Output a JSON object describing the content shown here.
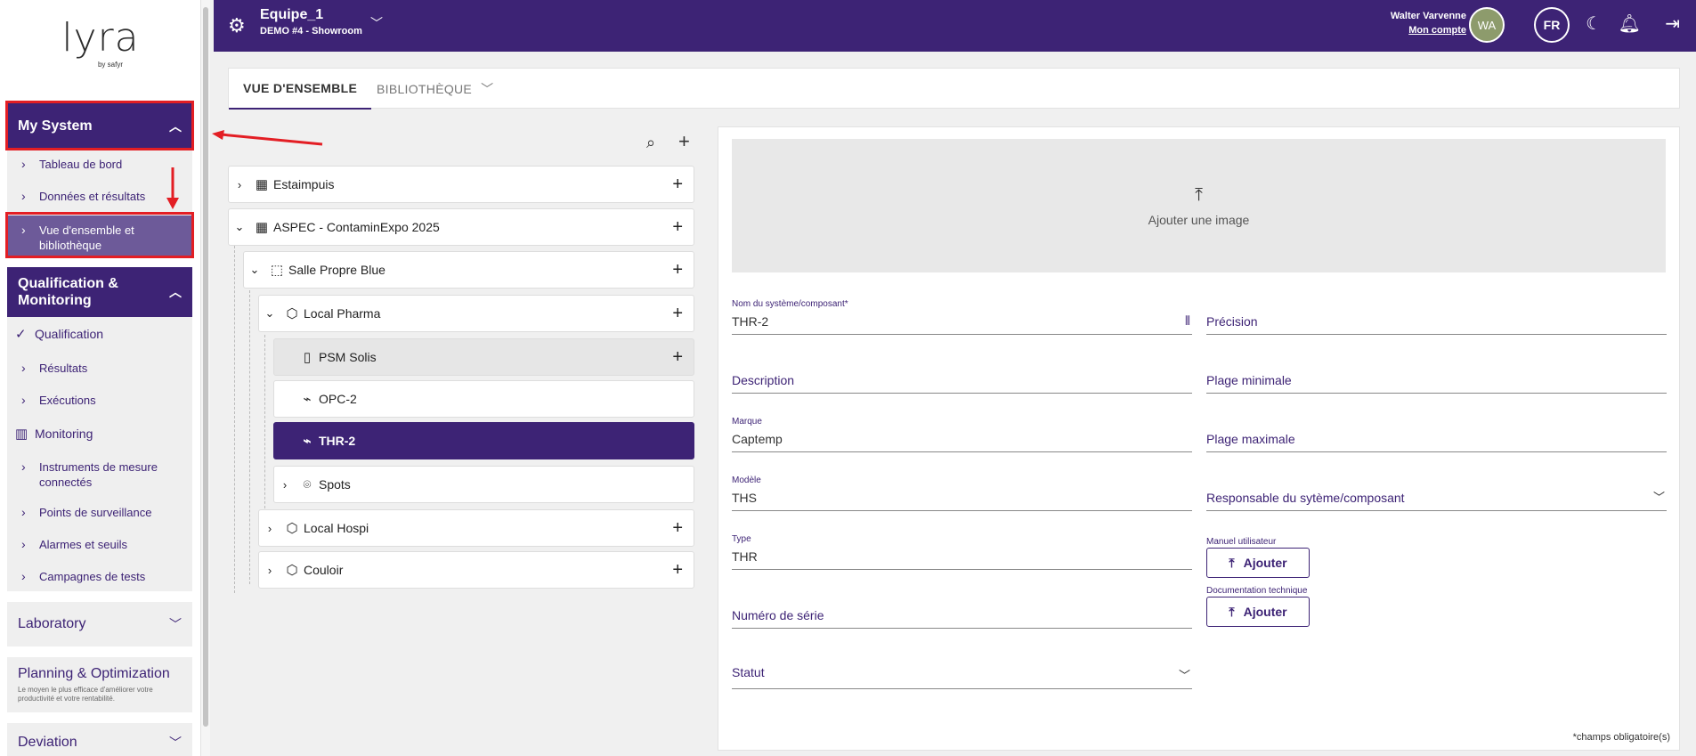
{
  "logo": {
    "word": "lyra",
    "by": "by safyr"
  },
  "sidebar": {
    "my_system": {
      "label": "My System",
      "items": [
        "Tableau de bord",
        "Données et résultats",
        "Vue d'ensemble et bibliothèque"
      ]
    },
    "qualification": {
      "label": "Qualification & Monitoring",
      "qualification_label": "Qualification",
      "qualification_items": [
        "Résultats",
        "Exécutions"
      ],
      "monitoring_label": "Monitoring",
      "monitoring_items": [
        "Instruments de mesure connectés",
        "Points de surveillance",
        "Alarmes et seuils",
        "Campagnes de tests"
      ]
    },
    "laboratory": {
      "label": "Laboratory"
    },
    "planning": {
      "label": "Planning & Optimization",
      "sub": "Le moyen le plus efficace d'améliorer votre productivité et votre rentabilité."
    },
    "deviation": {
      "label": "Deviation"
    }
  },
  "topbar": {
    "team": "Equipe_1",
    "site": "DEMO #4 - Showroom",
    "user_name": "Walter Varvenne",
    "account_link": "Mon compte",
    "avatar_initials": "WA",
    "language": "FR"
  },
  "tabs": {
    "overview": "VUE D'ENSEMBLE",
    "library": "BIBLIOTHÈQUE"
  },
  "tree": {
    "nodes": [
      {
        "label": "Estaimpuis"
      },
      {
        "label": "ASPEC - ContaminExpo 2025"
      },
      {
        "label": "Salle Propre Blue"
      },
      {
        "label": "Local Pharma"
      },
      {
        "label": "PSM Solis"
      },
      {
        "label": "OPC-2"
      },
      {
        "label": "THR-2"
      },
      {
        "label": "Spots"
      },
      {
        "label": "Local Hospi"
      },
      {
        "label": "Couloir"
      }
    ]
  },
  "detail": {
    "upload_label": "Ajouter une image",
    "name_label": "Nom du système/composant*",
    "name_value": "THR-2",
    "precision_label": "Précision",
    "description_label": "Description",
    "min_range_label": "Plage minimale",
    "brand_label": "Marque",
    "brand_value": "Captemp",
    "max_range_label": "Plage maximale",
    "model_label": "Modèle",
    "model_value": "THS",
    "owner_label": "Responsable du sytème/composant",
    "type_label": "Type",
    "type_value": "THR",
    "manual_label": "Manuel utilisateur",
    "add_button": "Ajouter",
    "tech_doc_label": "Documentation technique",
    "serial_label": "Numéro de série",
    "status_label": "Statut",
    "required_note": "*champs obligatoire(s)"
  },
  "colors": {
    "brand": "#3d2375",
    "annotation": "#e31e24"
  }
}
